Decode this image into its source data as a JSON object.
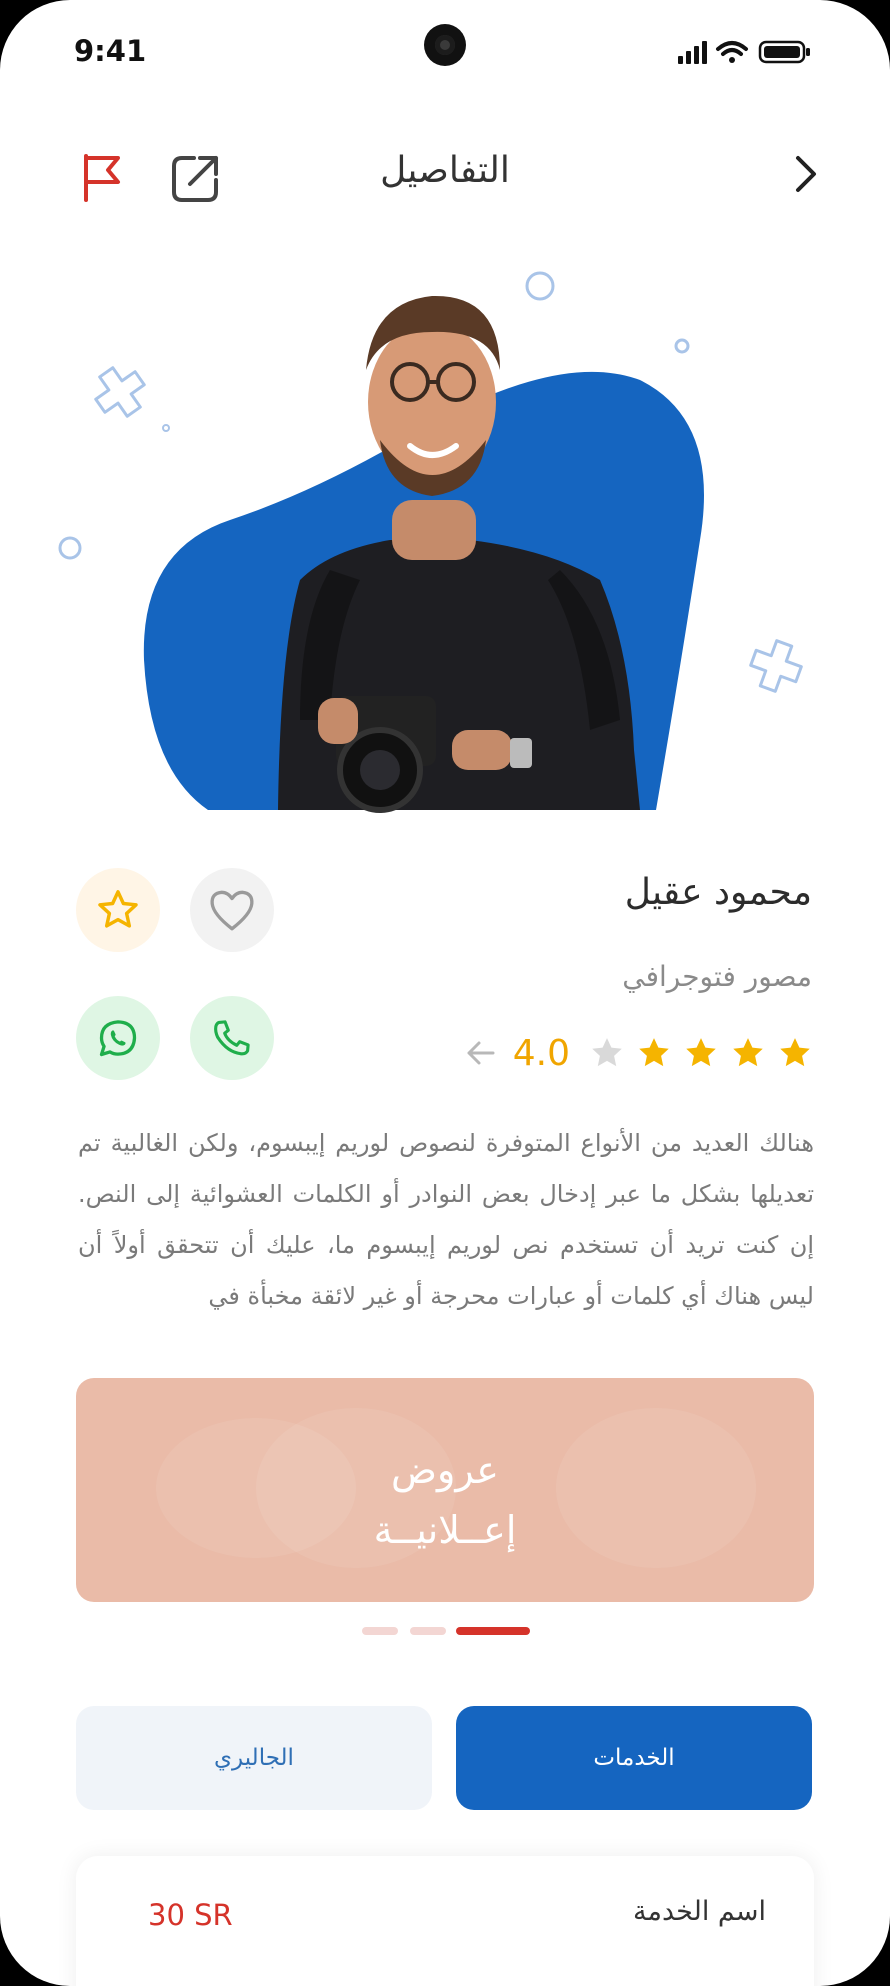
{
  "status_bar": {
    "time": "9:41"
  },
  "header": {
    "title": "التفاصيل"
  },
  "profile": {
    "name": "محمود عقيل",
    "job_title": "مصور فتوجرافي",
    "rating_value": "4.0",
    "rating_stars": 4,
    "rating_max": 5
  },
  "description": "هنالك العديد من الأنواع المتوفرة لنصوص لوريم إيبسوم، ولكن الغالبية تم تعديلها بشكل ما عبر إدخال بعض النوادر أو الكلمات العشوائية إلى النص. إن كنت تريد أن تستخدم نص لوريم إيبسوم ما، عليك أن تتحقق أولاً أن ليس هناك أي كلمات أو عبارات محرجة أو غير لائقة مخبأة في",
  "banner": {
    "line1": "عروض",
    "line2": "إعــلانيــة"
  },
  "carousel": {
    "total": 3,
    "active_index": 2
  },
  "tabs": {
    "services": "الخدمات",
    "gallery": "الجاليري",
    "active": "services"
  },
  "service_row": {
    "name": "اسم الخدمة",
    "price": "30 SR"
  },
  "colors": {
    "primary": "#1565c0",
    "accent_red": "#d5332a",
    "star": "#f5b400",
    "banner": "#eabba8"
  },
  "icons": {
    "report": "flag-icon",
    "share": "share-icon",
    "back": "chevron-right-icon",
    "favorite": "heart-icon",
    "rate": "star-icon",
    "whatsapp": "whatsapp-icon",
    "call": "phone-icon"
  }
}
